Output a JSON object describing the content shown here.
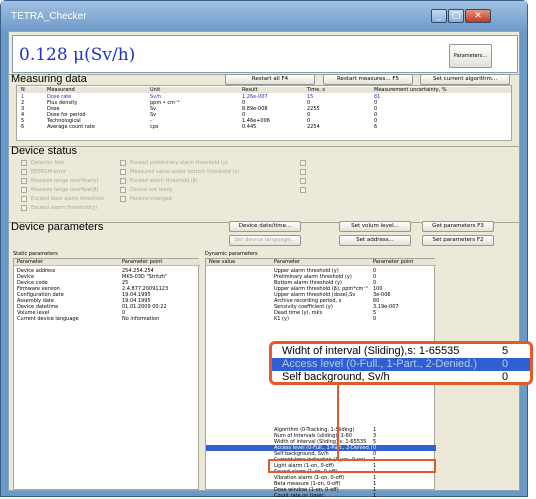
{
  "window": {
    "title": "TETRA_Checker",
    "min": "_",
    "max": "□",
    "close": "✕"
  },
  "rate": {
    "value": "0.128 μ(Sv/h)",
    "params_button": "Parameters..."
  },
  "measuring": {
    "title": "Measuring data",
    "buttons": [
      "Restart all F4",
      "Restart measures... F5",
      "Set current algorithm..."
    ],
    "headers": [
      "N",
      "Measurand",
      "Unit",
      "Result",
      "Time, s",
      "Measurement uncertainty, %"
    ],
    "rows": [
      [
        "1",
        "Dose rate",
        "Sv/h",
        "1.26e-007",
        "15",
        "81"
      ],
      [
        "2",
        "Flux density",
        "ppm • cm⁻²",
        "0",
        "0",
        "0"
      ],
      [
        "3",
        "Dose",
        "Sv",
        "8.89e-008",
        "2255",
        "0"
      ],
      [
        "4",
        "Dose for period",
        "Sv",
        "0",
        "0",
        "0"
      ],
      [
        "5",
        "Technological",
        "-",
        "1.46e+006",
        "0",
        "0"
      ],
      [
        "6",
        "Average count rate",
        "cps",
        "0.445",
        "2254",
        "6"
      ]
    ]
  },
  "status": {
    "title": "Device status",
    "col1": [
      "Detector fails",
      "EEPROM error",
      "Measure range overflow(y)",
      "Measure range overflow(β)",
      "Exceed dose alarm threshold",
      "Exceed alarm threshold(y)"
    ],
    "col2": [
      "Exceed preliminary alarm threshold (y)",
      "Measured value under bottom threshold (y)",
      "Exceed alarm threshold (β)",
      "Device not ready",
      "Params changed"
    ]
  },
  "device": {
    "title": "Device parameters",
    "buttons": [
      "Device date/time...",
      "Set volum level...",
      "Get parameters F3",
      "Set device language...",
      "Set address...",
      "Set parameters F2"
    ]
  },
  "static": {
    "title": "Static parameters",
    "headers": [
      "Parameter",
      "Parameter point"
    ],
    "rows": [
      [
        "Device address",
        "254.254.254"
      ],
      [
        "Device",
        "MKS-03D \"Stritzh\""
      ],
      [
        "Device code",
        "25"
      ],
      [
        "Firmware version",
        "2.4.877.20091123"
      ],
      [
        "Configuration date",
        "19.04.1995"
      ],
      [
        "Assembly date",
        "19.04.1995"
      ],
      [
        "Device datetime",
        "01.01.2009 00:22"
      ],
      [
        "Volume level",
        "0"
      ],
      [
        "Current device language",
        "No information"
      ]
    ]
  },
  "dynamic": {
    "title": "Dynamic parameters",
    "headers": [
      "New value",
      "Parameter",
      "Parameter point"
    ],
    "rows": [
      [
        "Upper alarm threshold (y)",
        "0"
      ],
      [
        "Preliminary alarm threshold (y)",
        "0"
      ],
      [
        "Bottom alarm threshold (y)",
        "0"
      ],
      [
        "Upper alarm threshold (β), ppm*cm⁻²",
        "100"
      ],
      [
        "Upper alarm threshold (dose),Sv",
        "3e-006"
      ],
      [
        "Archive recording period, s",
        "60"
      ],
      [
        "Sensivity coefficient (y)",
        "3.19e-007"
      ],
      [
        "Dead time (y), mks",
        "5"
      ],
      [
        "K1 (y)",
        "0"
      ]
    ],
    "rows2": [
      [
        "Algorithm (0-Tracking, 1-Sliding)",
        "1"
      ],
      [
        "Num of Intervals (sliding): 1-60",
        "3"
      ],
      [
        "Width of interval (Sliding),s: 1-65535",
        "5"
      ],
      [
        "Access level (0-Full., 1-Part., 2-Denied.)",
        "0"
      ],
      [
        "Self background, Sv/h",
        "0"
      ],
      [
        "Current time indication (1-yes, 0-no)",
        "1"
      ],
      [
        "Light alarm (1-on, 0-off)",
        "1"
      ],
      [
        "Sound alarm (1-on, 0-off)",
        "1"
      ],
      [
        "Vibration alarm (1-on, 0-off)",
        "1"
      ],
      [
        "Beta measure (1-on, 0-off)",
        "1"
      ],
      [
        "Dose window (1-on, 0-off)",
        "1"
      ],
      [
        "Count rate on timer:",
        "1"
      ]
    ]
  },
  "popup": {
    "rows": [
      [
        "Widht of interval (Sliding),s: 1-65535",
        "5"
      ],
      [
        "Access level (0-Full., 1-Part., 2-Denied.)",
        "0"
      ],
      [
        "Self background, Sv/h",
        "0"
      ]
    ]
  },
  "colors": {
    "selection": "#2f5fd0",
    "highlight": "#e4592a"
  }
}
